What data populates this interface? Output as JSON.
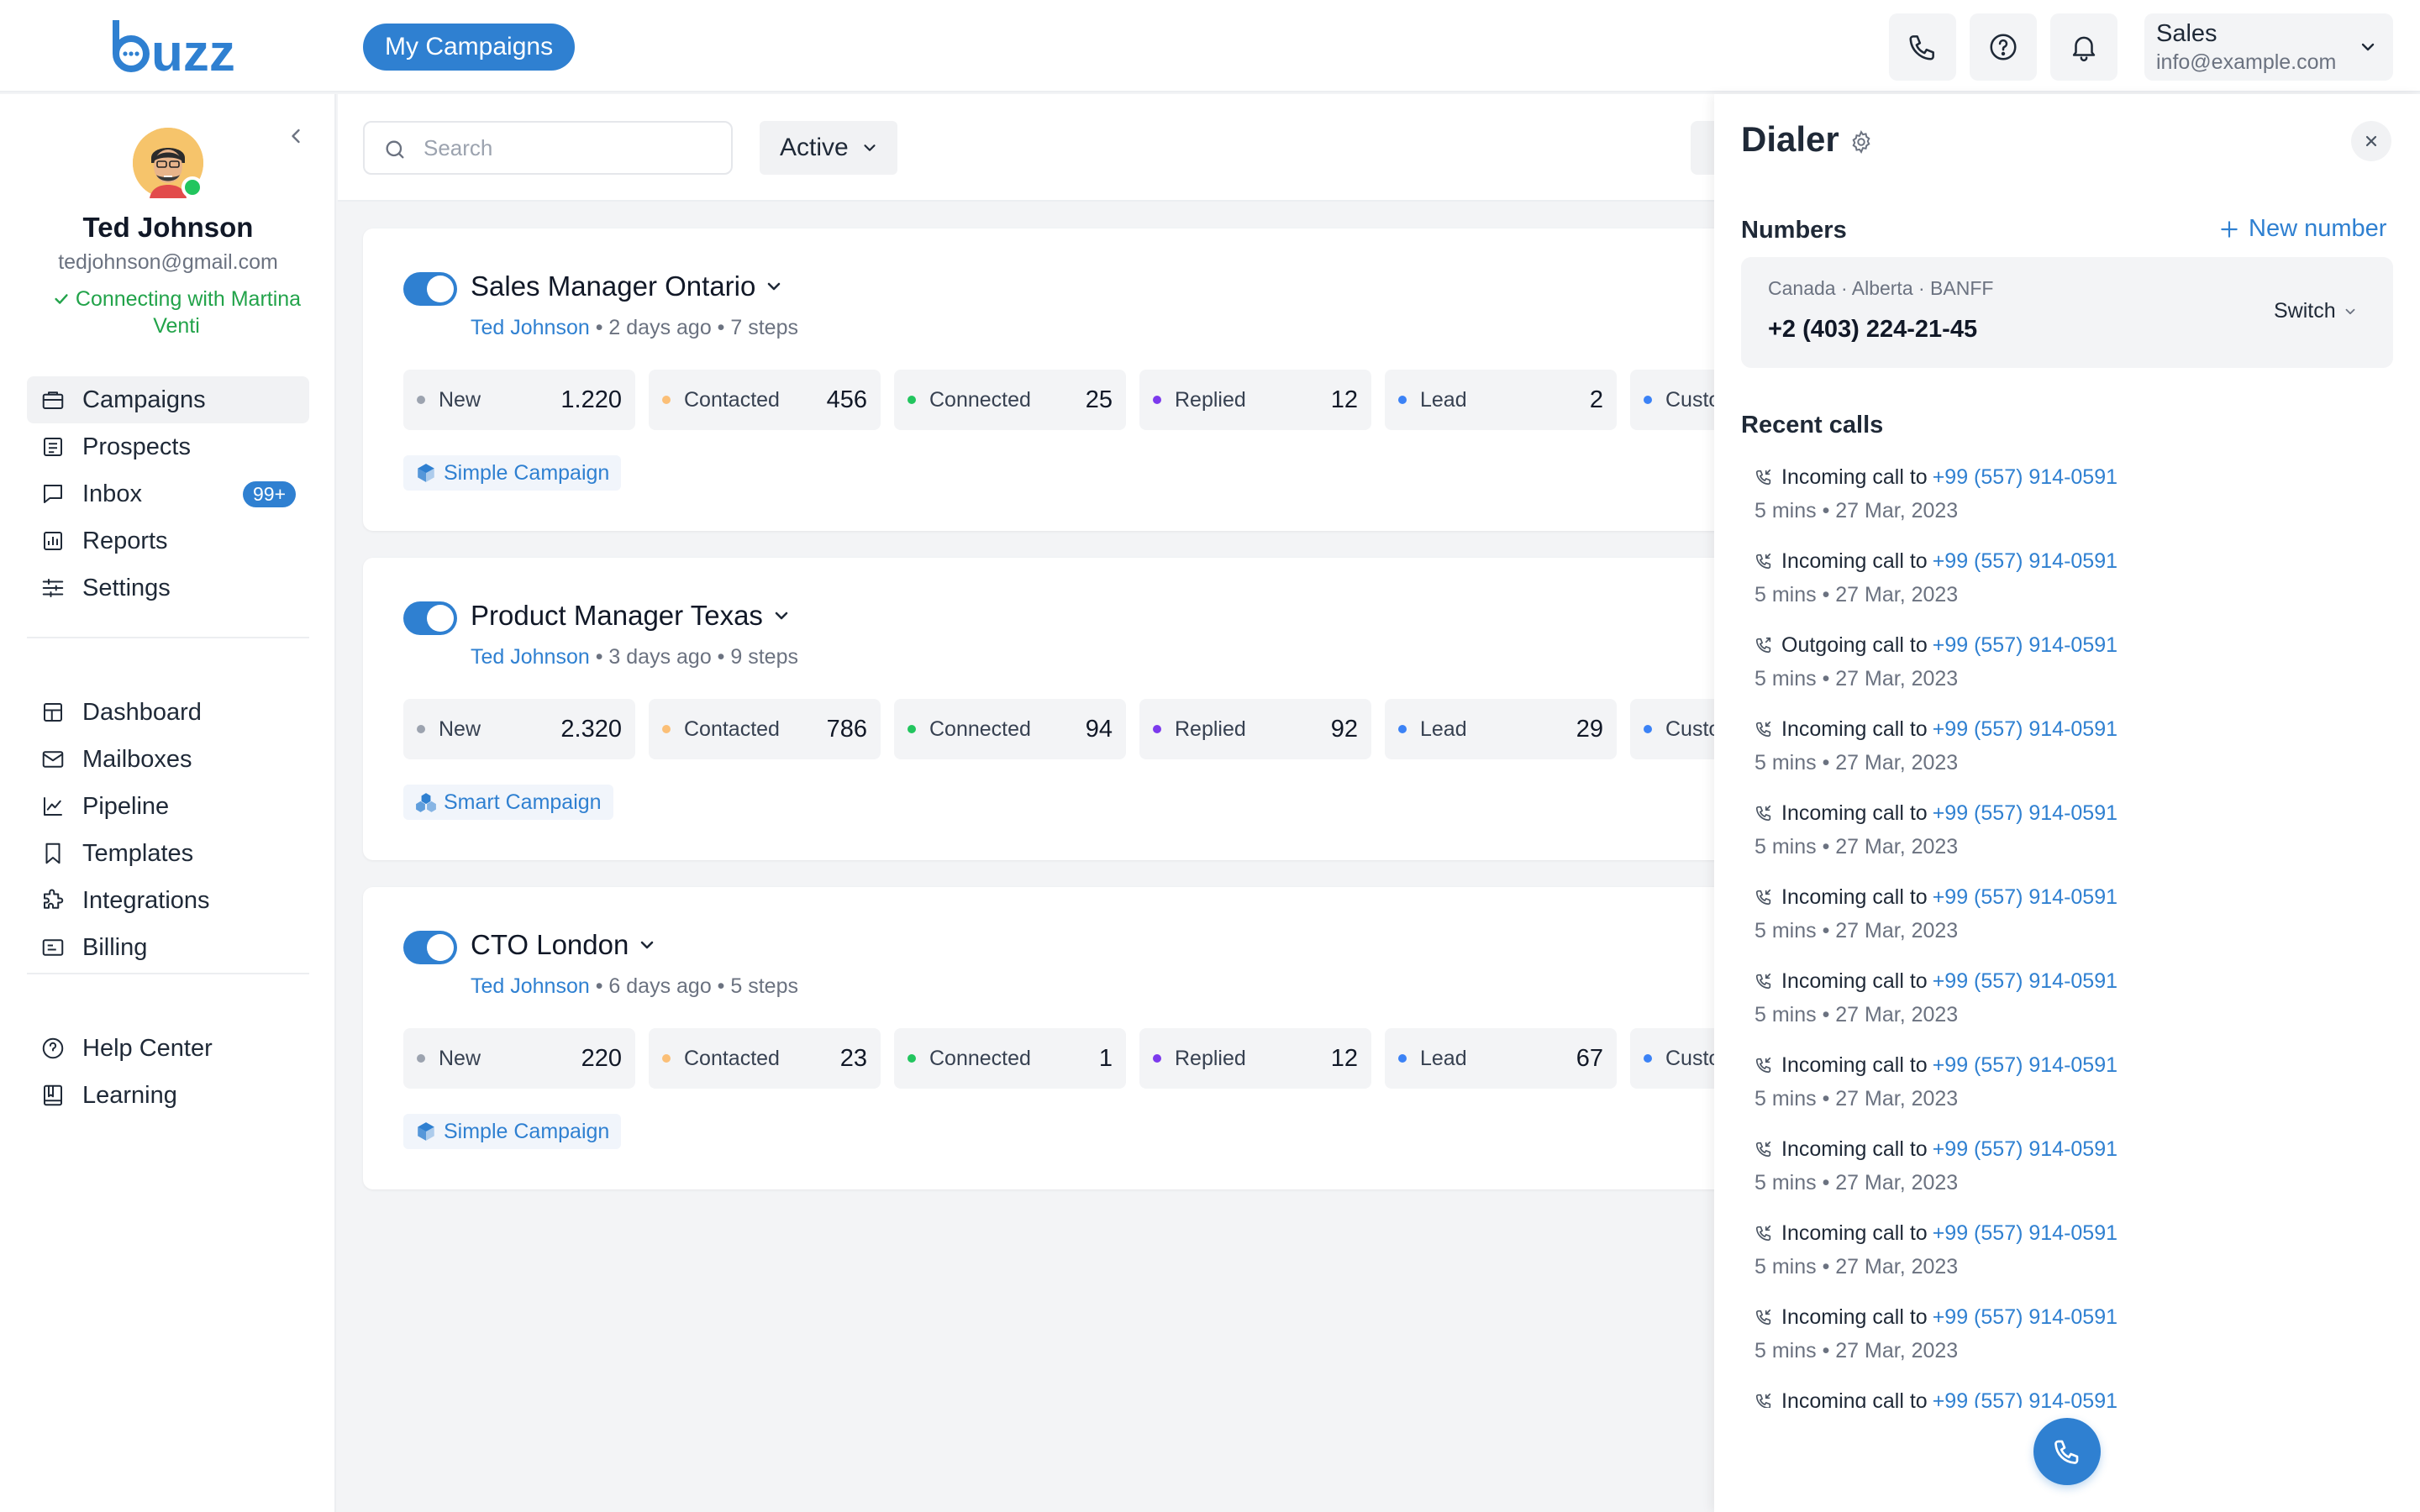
{
  "header": {
    "logo_text": "buzz",
    "my_campaigns_label": "My Campaigns",
    "account_name": "Sales",
    "account_email": "info@example.com",
    "icons": [
      "phone-icon",
      "help-icon",
      "bell-icon"
    ]
  },
  "sidebar": {
    "user": {
      "name": "Ted Johnson",
      "email": "tedjohnson@gmail.com",
      "status": "Connecting with Martina Venti"
    },
    "nav_primary": [
      {
        "label": "Campaigns",
        "icon": "briefcase-icon",
        "active": true
      },
      {
        "label": "Prospects",
        "icon": "list-icon"
      },
      {
        "label": "Inbox",
        "icon": "chat-icon",
        "badge": "99+"
      },
      {
        "label": "Reports",
        "icon": "chart-icon"
      },
      {
        "label": "Settings",
        "icon": "sliders-icon"
      }
    ],
    "nav_secondary": [
      {
        "label": "Dashboard",
        "icon": "dashboard-icon"
      },
      {
        "label": "Mailboxes",
        "icon": "mail-icon"
      },
      {
        "label": "Pipeline",
        "icon": "pipeline-icon"
      },
      {
        "label": "Templates",
        "icon": "bookmark-icon"
      },
      {
        "label": "Integrations",
        "icon": "puzzle-icon"
      },
      {
        "label": "Billing",
        "icon": "billing-icon"
      }
    ],
    "nav_tertiary": [
      {
        "label": "Help Center",
        "icon": "help-icon"
      },
      {
        "label": "Learning",
        "icon": "book-icon"
      }
    ]
  },
  "toolbar": {
    "search_placeholder": "Search",
    "filter_label": "Active"
  },
  "status_colors": {
    "New": "#9ca3af",
    "Contacted": "#fbbf77",
    "Connected": "#22c55e",
    "Replied": "#7c3aed",
    "Lead": "#3b82f6",
    "Customer": "#3b82f6"
  },
  "campaigns": [
    {
      "title": "Sales Manager Ontario",
      "owner": "Ted Johnson",
      "meta": " • 2 days ago • 7 steps",
      "enabled": true,
      "type": "Simple Campaign",
      "stats": [
        {
          "label": "New",
          "value": "1.220"
        },
        {
          "label": "Contacted",
          "value": "456"
        },
        {
          "label": "Connected",
          "value": "25"
        },
        {
          "label": "Replied",
          "value": "12"
        },
        {
          "label": "Lead",
          "value": "2"
        },
        {
          "label": "Custo",
          "value": ""
        }
      ]
    },
    {
      "title": "Product Manager Texas",
      "owner": "Ted Johnson",
      "meta": " • 3 days ago • 9 steps",
      "enabled": true,
      "type": "Smart Campaign",
      "stats": [
        {
          "label": "New",
          "value": "2.320"
        },
        {
          "label": "Contacted",
          "value": "786"
        },
        {
          "label": "Connected",
          "value": "94"
        },
        {
          "label": "Replied",
          "value": "92"
        },
        {
          "label": "Lead",
          "value": "29"
        },
        {
          "label": "Custo",
          "value": ""
        }
      ]
    },
    {
      "title": "CTO London",
      "owner": "Ted Johnson",
      "meta": " • 6 days ago • 5 steps",
      "enabled": true,
      "type": "Simple Campaign",
      "stats": [
        {
          "label": "New",
          "value": "220"
        },
        {
          "label": "Contacted",
          "value": "23"
        },
        {
          "label": "Connected",
          "value": "1"
        },
        {
          "label": "Replied",
          "value": "12"
        },
        {
          "label": "Lead",
          "value": "67"
        },
        {
          "label": "Custo",
          "value": ""
        }
      ]
    }
  ],
  "dialer": {
    "title": "Dialer",
    "numbers_label": "Numbers",
    "new_number_label": "New number",
    "number": {
      "location": "Canada · Alberta · BANFF",
      "phone": "+2 (403) 224-21-45",
      "switch_label": "Switch"
    },
    "recent_calls_label": "Recent calls",
    "calls": [
      {
        "direction": "Incoming call to",
        "number": "+99 (557) 914-0591",
        "detail": "5 mins • 27 Mar, 2023"
      },
      {
        "direction": "Incoming call to",
        "number": "+99 (557) 914-0591",
        "detail": "5 mins • 27 Mar, 2023"
      },
      {
        "direction": "Outgoing call to",
        "number": "+99 (557) 914-0591",
        "detail": "5 mins • 27 Mar, 2023"
      },
      {
        "direction": "Incoming call to",
        "number": "+99 (557) 914-0591",
        "detail": "5 mins • 27 Mar, 2023"
      },
      {
        "direction": "Incoming call to",
        "number": "+99 (557) 914-0591",
        "detail": "5 mins • 27 Mar, 2023"
      },
      {
        "direction": "Incoming call to",
        "number": "+99 (557) 914-0591",
        "detail": "5 mins • 27 Mar, 2023"
      },
      {
        "direction": "Incoming call to",
        "number": "+99 (557) 914-0591",
        "detail": "5 mins • 27 Mar, 2023"
      },
      {
        "direction": "Incoming call to",
        "number": "+99 (557) 914-0591",
        "detail": "5 mins • 27 Mar, 2023"
      },
      {
        "direction": "Incoming call to",
        "number": "+99 (557) 914-0591",
        "detail": "5 mins • 27 Mar, 2023"
      },
      {
        "direction": "Incoming call to",
        "number": "+99 (557) 914-0591",
        "detail": "5 mins • 27 Mar, 2023"
      },
      {
        "direction": "Incoming call to",
        "number": "+99 (557) 914-0591",
        "detail": "5 mins • 27 Mar, 2023"
      },
      {
        "direction": "Incoming call to",
        "number": "+99 (557) 914-0591",
        "detail": ""
      }
    ]
  }
}
